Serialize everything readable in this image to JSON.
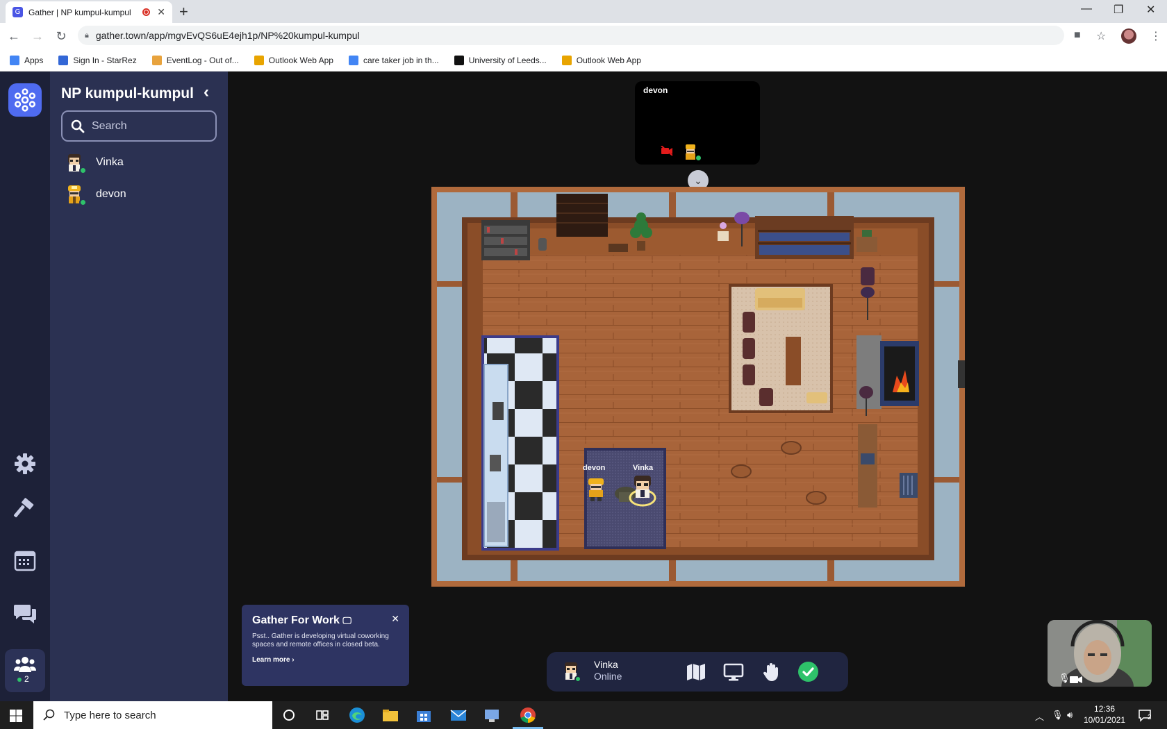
{
  "browser": {
    "tab_title": "Gather | NP kumpul-kumpul",
    "tab_favicon": "gather-favicon",
    "url": "gather.town/app/mgvEvQS6uE4ejh1p/NP%20kumpul-kumpul",
    "bookmarks": [
      {
        "label": "Apps",
        "icon": "apps-grid-icon",
        "color": "#4285f4"
      },
      {
        "label": "Sign In - StarRez",
        "icon": "star-icon",
        "color": "#3367d6"
      },
      {
        "label": "EventLog - Out of...",
        "icon": "document-icon",
        "color": "#e8a33d"
      },
      {
        "label": "Outlook Web App",
        "icon": "outlook-icon",
        "color": "#e8a400"
      },
      {
        "label": "care taker job in th...",
        "icon": "google-icon",
        "color": "#4285f4"
      },
      {
        "label": "University of Leeds...",
        "icon": "leeds-icon",
        "color": "#111111"
      },
      {
        "label": "Outlook Web App",
        "icon": "outlook-icon",
        "color": "#e8a400"
      }
    ]
  },
  "sidebar": {
    "space_name": "NP kumpul-kumpul",
    "search_placeholder": "Search",
    "players": [
      {
        "name": "Vinka",
        "status": "online"
      },
      {
        "name": "devon",
        "status": "online"
      }
    ]
  },
  "rail": {
    "people_count": "2"
  },
  "video": {
    "participant_name": "devon"
  },
  "map": {
    "labels": {
      "devon": "devon",
      "vinka": "Vinka"
    }
  },
  "promo": {
    "title": "Gather For Work",
    "text": "Psst.. Gather is developing virtual coworking spaces and remote offices in closed beta.",
    "link": "Learn more ›"
  },
  "me": {
    "name": "Vinka",
    "status": "Online"
  },
  "taskbar": {
    "search_placeholder": "Type here to search",
    "time": "12:36",
    "date": "10/01/2021"
  },
  "colors": {
    "accent": "#4f6bf0",
    "online": "#2ec26a",
    "sidebar_bg": "#2b3152",
    "rail_bg": "#1d2138"
  }
}
